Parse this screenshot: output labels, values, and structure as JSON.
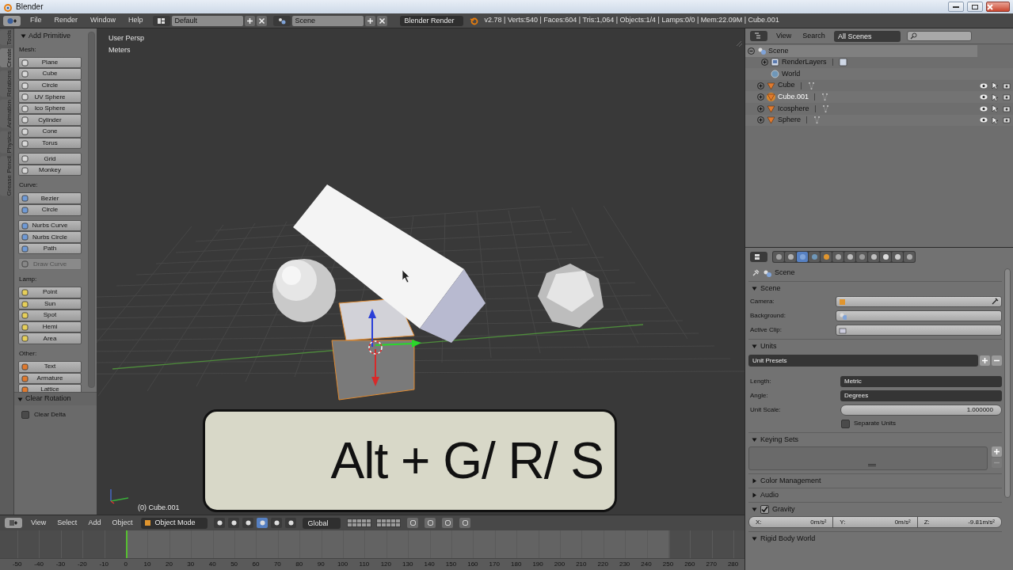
{
  "title_bar": {
    "title": "Blender"
  },
  "info_header": {
    "menus": [
      "File",
      "Render",
      "Window",
      "Help"
    ],
    "layout": "Default",
    "scene": "Scene",
    "engine": "Blender Render",
    "stats": "v2.78 | Verts:540 | Faces:604 | Tris:1,064 | Objects:1/4 | Lamps:0/0 | Mem:22.09M | Cube.001"
  },
  "tool_tabs": [
    {
      "label": "Tools",
      "selected": false
    },
    {
      "label": "Create",
      "selected": true
    },
    {
      "label": "Relations",
      "selected": false
    },
    {
      "label": "Animation",
      "selected": false
    },
    {
      "label": "Physics",
      "selected": false
    },
    {
      "label": "Grease Pencil",
      "selected": false
    }
  ],
  "tool_panel": {
    "title": "Add Primitive",
    "expanded": true,
    "groups": [
      {
        "label": "Mesh:",
        "blocks": [
          [
            {
              "label": "Plane",
              "disabled": false
            },
            {
              "label": "Cube",
              "disabled": false
            },
            {
              "label": "Circle",
              "disabled": false
            },
            {
              "label": "UV Sphere",
              "disabled": false
            },
            {
              "label": "Ico Sphere",
              "disabled": false
            },
            {
              "label": "Cylinder",
              "disabled": false
            },
            {
              "label": "Cone",
              "disabled": false
            },
            {
              "label": "Torus",
              "disabled": false
            }
          ],
          [
            {
              "label": "Grid",
              "disabled": false
            },
            {
              "label": "Monkey",
              "disabled": false
            }
          ]
        ]
      },
      {
        "label": "Curve:",
        "blocks": [
          [
            {
              "label": "Bezier",
              "disabled": false
            },
            {
              "label": "Circle",
              "disabled": false
            }
          ],
          [
            {
              "label": "Nurbs Curve",
              "disabled": false
            },
            {
              "label": "Nurbs Circle",
              "disabled": false
            },
            {
              "label": "Path",
              "disabled": false
            }
          ],
          [
            {
              "label": "Draw Curve",
              "disabled": true
            }
          ]
        ]
      },
      {
        "label": "Lamp:",
        "blocks": [
          [
            {
              "label": "Point",
              "disabled": false
            },
            {
              "label": "Sun",
              "disabled": false
            },
            {
              "label": "Spot",
              "disabled": false
            },
            {
              "label": "Hemi",
              "disabled": false
            },
            {
              "label": "Area",
              "disabled": false
            }
          ]
        ]
      },
      {
        "label": "Other:",
        "blocks": [
          [
            {
              "label": "Text",
              "disabled": false
            },
            {
              "label": "Armature",
              "disabled": false
            },
            {
              "label": "Lattice",
              "disabled": false
            }
          ]
        ]
      }
    ]
  },
  "operator_panel": {
    "title": "Clear Rotation",
    "expanded": true,
    "options": [
      {
        "label": "Clear Delta",
        "checked": false
      }
    ]
  },
  "viewport": {
    "view_label": "User Persp",
    "units": "Meters",
    "object_label": "(0) Cube.001",
    "caption": "Alt + G/ R/ S"
  },
  "view3d_header": {
    "menus": [
      "View",
      "Select",
      "Add",
      "Object"
    ],
    "mode": "Object Mode",
    "orientation": "Global"
  },
  "timeline": {
    "ticks": [
      "-50",
      "-40",
      "-30",
      "-20",
      "-10",
      "0",
      "10",
      "20",
      "30",
      "40",
      "50",
      "60",
      "70",
      "80",
      "90",
      "100",
      "110",
      "120",
      "130",
      "140",
      "150",
      "160",
      "170",
      "180",
      "190",
      "200",
      "210",
      "220",
      "230",
      "240",
      "250",
      "260",
      "270",
      "280"
    ]
  },
  "outliner": {
    "menus": [
      "View",
      "Search"
    ],
    "filter": "All Scenes",
    "tree": [
      {
        "label": "Scene",
        "kind": "scene",
        "expanded": true,
        "children": [
          {
            "label": "RenderLayers",
            "kind": "layers",
            "expanded": false,
            "selected": false
          },
          {
            "label": "World",
            "kind": "world",
            "selected": false
          },
          {
            "label": "Cube",
            "kind": "object",
            "expanded": false,
            "selected": false
          },
          {
            "label": "Cube.001",
            "kind": "object",
            "expanded": false,
            "selected": true
          },
          {
            "label": "Icosphere",
            "kind": "object",
            "expanded": false,
            "selected": false
          },
          {
            "label": "Sphere",
            "kind": "object",
            "expanded": false,
            "selected": false
          }
        ]
      }
    ]
  },
  "properties": {
    "context_tabs": [
      {
        "selected": false
      },
      {
        "selected": false
      },
      {
        "selected": true
      },
      {
        "selected": false
      },
      {
        "selected": false
      },
      {
        "selected": false
      },
      {
        "selected": false
      },
      {
        "selected": false
      },
      {
        "selected": false
      },
      {
        "selected": false
      },
      {
        "selected": false
      },
      {
        "selected": false
      }
    ],
    "breadcrumb": "Scene",
    "panels": [
      {
        "kind": "scene",
        "title": "Scene",
        "expanded": true,
        "fields": [
          {
            "label": "Camera:"
          },
          {
            "label": "Background:"
          },
          {
            "label": "Active Clip:"
          }
        ]
      },
      {
        "kind": "units",
        "title": "Units",
        "expanded": true,
        "preset": "Unit Presets",
        "rows": [
          {
            "label": "Length:",
            "value": "Metric",
            "kind": "menu"
          },
          {
            "label": "Angle:",
            "value": "Degrees",
            "kind": "menu"
          },
          {
            "label": "Unit Scale:",
            "value": "1.000000",
            "kind": "number"
          }
        ],
        "option": {
          "label": "Separate Units",
          "checked": false
        }
      },
      {
        "kind": "keying",
        "title": "Keying Sets",
        "expanded": true
      },
      {
        "kind": "plain",
        "title": "Color Management",
        "expanded": false
      },
      {
        "kind": "plain",
        "title": "Audio",
        "expanded": false
      },
      {
        "kind": "gravity",
        "title": "Gravity",
        "expanded": true,
        "checked": true,
        "values": [
          {
            "axis": "X:",
            "value": "0m/s²"
          },
          {
            "axis": "Y:",
            "value": "0m/s²"
          },
          {
            "axis": "Z:",
            "value": "-9.81m/s²"
          }
        ]
      },
      {
        "kind": "plain",
        "title": "Rigid Body World",
        "expanded": true
      }
    ]
  }
}
